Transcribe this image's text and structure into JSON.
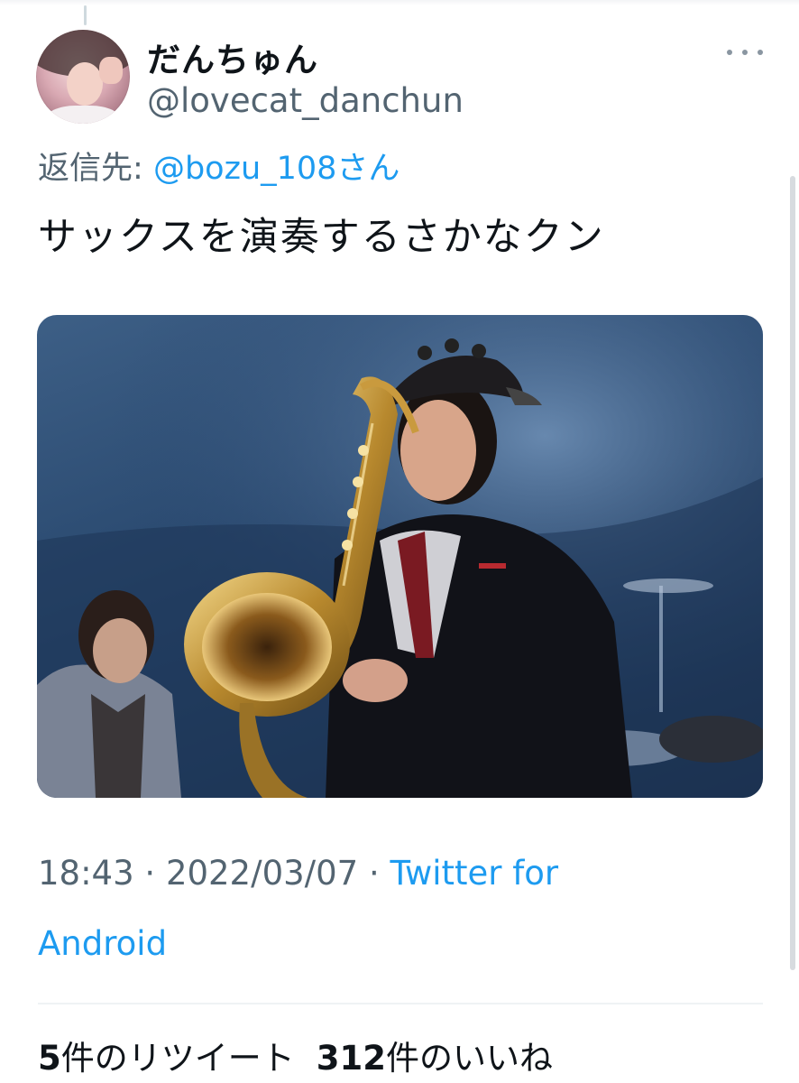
{
  "tweet": {
    "display_name": "だんちゅん",
    "handle": "@lovecat_danchun",
    "reply_prefix": "返信先:",
    "reply_mention": "@bozu_108さん",
    "text": "サックスを演奏するさかなクン",
    "time": "18:43",
    "separator": "·",
    "date": "2022/03/07",
    "source_line1": "Twitter for",
    "source_line2": "Android",
    "retweet_count": "5",
    "retweet_label": "件のリツイート",
    "like_count": "312",
    "like_label": "件のいいね"
  },
  "icons": {
    "more": "more-horizontal-icon",
    "avatar": "avatar-image"
  },
  "colors": {
    "link": "#1d9bf0",
    "secondary_text": "#536471",
    "primary_text": "#0f1419"
  }
}
